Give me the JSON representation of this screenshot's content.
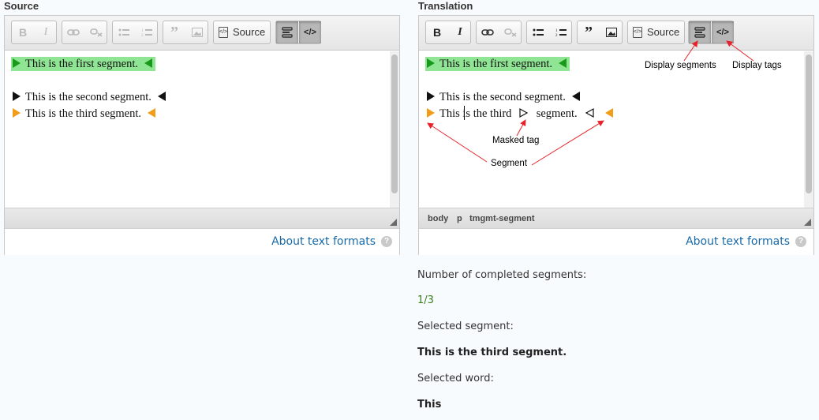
{
  "source_panel": {
    "title": "Source",
    "toolbar": {
      "source_label": "Source"
    },
    "segments": [
      "This is the first segment.",
      "This is the second segment.",
      "This is the third segment."
    ],
    "about_link": "About text formats",
    "help_glyph": "?"
  },
  "translation_panel": {
    "title": "Translation",
    "toolbar": {
      "source_label": "Source"
    },
    "segments": {
      "first": "This is the first segment.",
      "second": "This is the second segment.",
      "third_start": "This is the third",
      "third_end": "segment."
    },
    "status_path": [
      "body",
      "p",
      "tmgmt-segment"
    ],
    "about_link": "About text formats",
    "help_glyph": "?",
    "annotations": {
      "display_segments": "Display segments",
      "display_tags": "Display tags",
      "masked_tag": "Masked tag",
      "segment": "Segment"
    }
  },
  "info": {
    "completed_label": "Number of completed segments:",
    "completed_value": "1/3",
    "selected_segment_label": "Selected segment:",
    "selected_segment_value": "This is the third segment.",
    "selected_word_label": "Selected word:",
    "selected_word_value": "This"
  },
  "colors": {
    "completed_segment_bg": "#90e594",
    "completed_marker": "#1a9a1a",
    "active_marker": "#f29d1a",
    "link": "#1a6aa8",
    "annotation_arrow": "#e8222a"
  },
  "icons": [
    "bold-icon",
    "italic-icon",
    "link-icon",
    "unlink-icon",
    "bulleted-list-icon",
    "numbered-list-icon",
    "blockquote-icon",
    "image-icon",
    "source-icon",
    "display-segments-icon",
    "display-tags-icon",
    "resize-handle-icon",
    "help-icon"
  ]
}
